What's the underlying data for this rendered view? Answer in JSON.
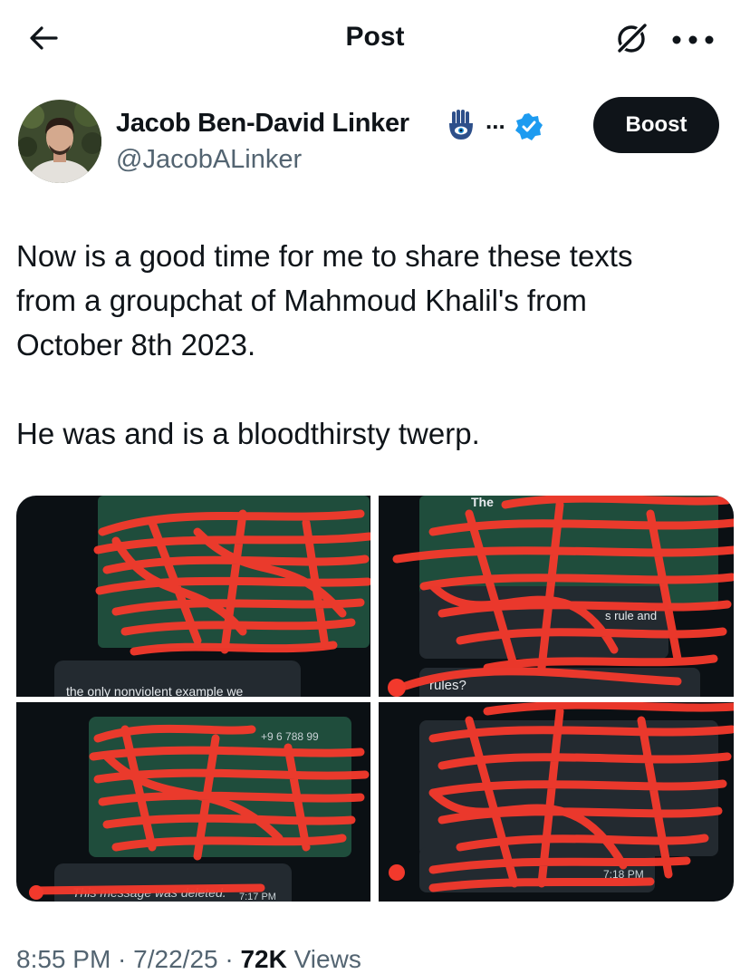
{
  "header": {
    "title": "Post"
  },
  "author": {
    "display_name": "Jacob Ben-David Linker",
    "name_ellipsis": "...",
    "handle": "@JacobALinker",
    "boost_label": "Boost",
    "badge_color": "#1d9bf0"
  },
  "tweet": {
    "text": "Now is a good time for me to share these texts\nfrom a groupchat of Mahmoud Khalil's from\nOctober 8th 2023.\n\nHe was and is a bloodthirsty twerp."
  },
  "media": {
    "tiles": [
      {
        "fragment": "the only nonviolent example we"
      },
      {
        "fragment_top": "The",
        "fragment_mid": "s rule and",
        "fragment_bottom": "rules?"
      },
      {
        "fragment_top": "+9 6 788 99"
      },
      {
        "fragment_bottom": "7:18 PM"
      }
    ],
    "deleted_note": "This message was deleted.",
    "deleted_time": "7:17 PM",
    "scribble_color": "#f2392c"
  },
  "meta": {
    "time": "8:55 PM",
    "date": "7/22/25",
    "views_count": "72K",
    "views_label": "Views"
  }
}
